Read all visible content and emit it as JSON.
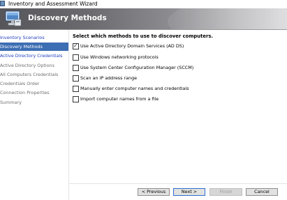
{
  "window": {
    "title": "Inventory and Assessment Wizard"
  },
  "banner": {
    "title": "Discovery Methods",
    "icon": "computer-monitor-icon"
  },
  "sidebar": {
    "items": [
      {
        "label": "Inventory Scenarios",
        "state": "link"
      },
      {
        "label": "Discovery Methods",
        "state": "selected"
      },
      {
        "label": "Active Directory Credentials",
        "state": "link"
      },
      {
        "label": "Active Directory Options",
        "state": "disabled"
      },
      {
        "label": "All Computers Credentials",
        "state": "disabled"
      },
      {
        "label": "Credentials Order",
        "state": "disabled"
      },
      {
        "label": "Connection Properties",
        "state": "disabled"
      },
      {
        "label": "Summary",
        "state": "disabled"
      }
    ]
  },
  "main": {
    "heading": "Select which methods to use to discover computers.",
    "options": [
      {
        "label": "Use Active Directory Domain Services (AD DS)",
        "checked": true
      },
      {
        "label": "Use Windows networking protocols",
        "checked": false
      },
      {
        "label": "Use System Center Configuration Manager (SCCM)",
        "checked": false
      },
      {
        "label": "Scan an IP address range",
        "checked": false
      },
      {
        "label": "Manually enter computer names and credentials",
        "checked": false
      },
      {
        "label": "Import computer names from a file",
        "checked": false
      }
    ]
  },
  "footer": {
    "previous_label": "< Previous",
    "next_label": "Next >",
    "finish_label": "Finish",
    "cancel_label": "Cancel"
  },
  "colors": {
    "link": "#1f3fbf",
    "selected_bg": "#3d6db3",
    "disabled_text": "#6e6e6e",
    "default_button_border": "#2b6fcf"
  }
}
